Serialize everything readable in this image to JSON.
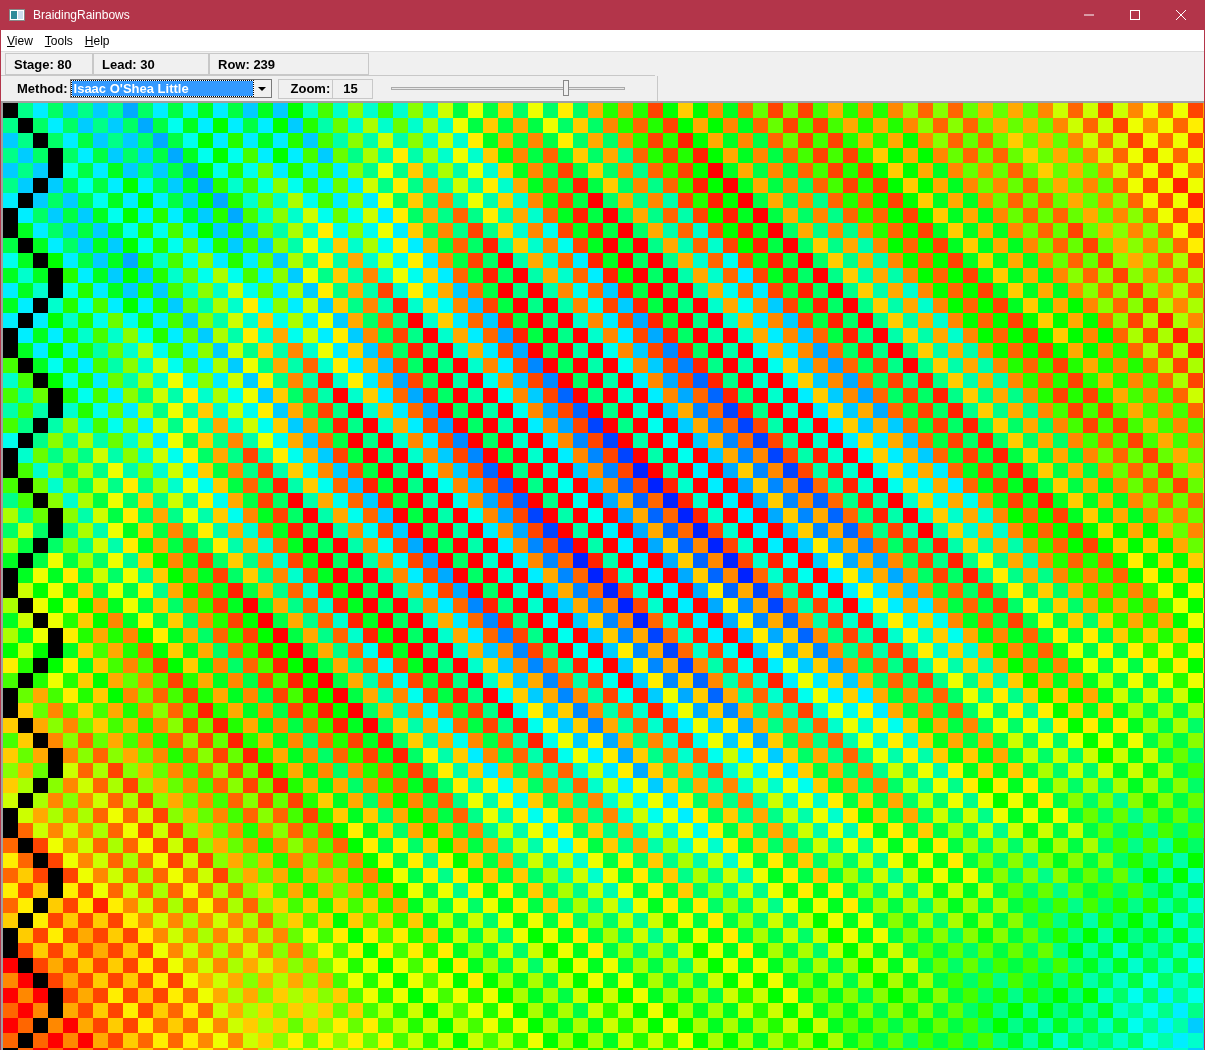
{
  "window": {
    "title": "BraidingRainbows"
  },
  "menu": [
    {
      "accel": "V",
      "rest": "iew"
    },
    {
      "accel": "T",
      "rest": "ools"
    },
    {
      "accel": "H",
      "rest": "elp"
    }
  ],
  "status": [
    "Stage: 80",
    "Lead: 30",
    "Row: 239"
  ],
  "toolbar": {
    "method_label": "Method:",
    "method_value": "Isaac O'Shea Little",
    "zoom_label": "Zoom:",
    "zoom_value": "15",
    "zoom_slider": {
      "level": 0.75
    }
  }
}
